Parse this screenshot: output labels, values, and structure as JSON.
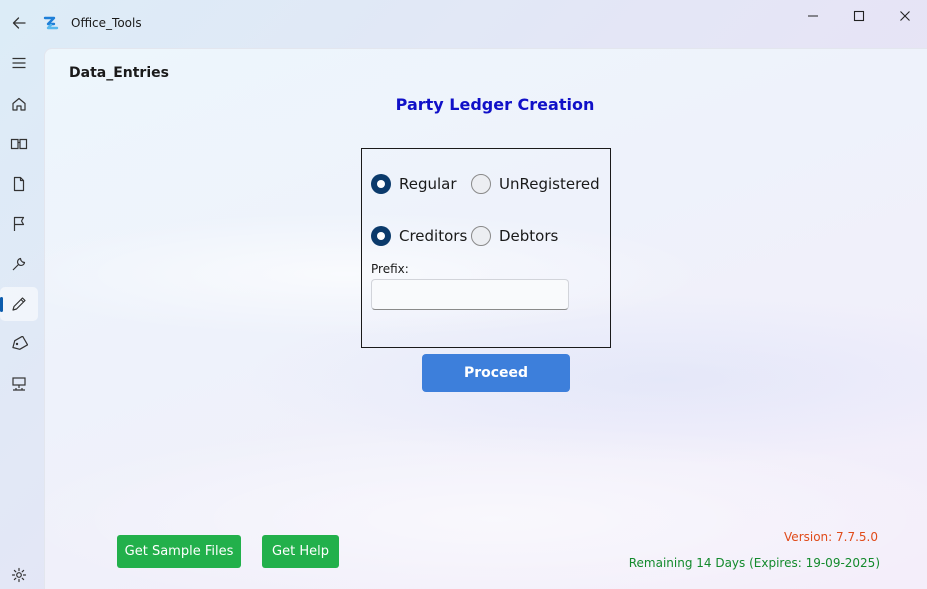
{
  "window": {
    "title": "Office_Tools"
  },
  "nav": {
    "items": [
      {
        "icon": "hamburger-menu-icon"
      },
      {
        "icon": "home-icon"
      },
      {
        "icon": "book-icon"
      },
      {
        "icon": "document-icon"
      },
      {
        "icon": "flag-icon"
      },
      {
        "icon": "wrench-icon"
      },
      {
        "icon": "pencil-icon",
        "active": true
      },
      {
        "icon": "tag-icon"
      },
      {
        "icon": "network-icon"
      },
      {
        "icon": "settings-gear-icon"
      }
    ]
  },
  "page": {
    "header": "Data_Entries",
    "title": "Party Ledger Creation"
  },
  "form": {
    "registration": {
      "options": [
        "Regular",
        "UnRegistered"
      ],
      "selected": "Regular"
    },
    "party_type": {
      "options": [
        "Creditors",
        "Debtors"
      ],
      "selected": "Creditors"
    },
    "prefix": {
      "label": "Prefix:",
      "value": "",
      "placeholder": ""
    },
    "proceed_label": "Proceed"
  },
  "footer": {
    "sample_files_label": "Get Sample Files",
    "help_label": "Get Help",
    "version": "Version: 7.7.5.0",
    "remaining": "Remaining 14 Days (Expires: 19-09-2025)"
  },
  "colors": {
    "title_blue": "#1010c8",
    "proceed_blue": "#3d7fdb",
    "green_button": "#22b04b",
    "version_orange": "#e04b1a",
    "remaining_green": "#138a2c",
    "radio_checked": "#0b3a6b"
  }
}
